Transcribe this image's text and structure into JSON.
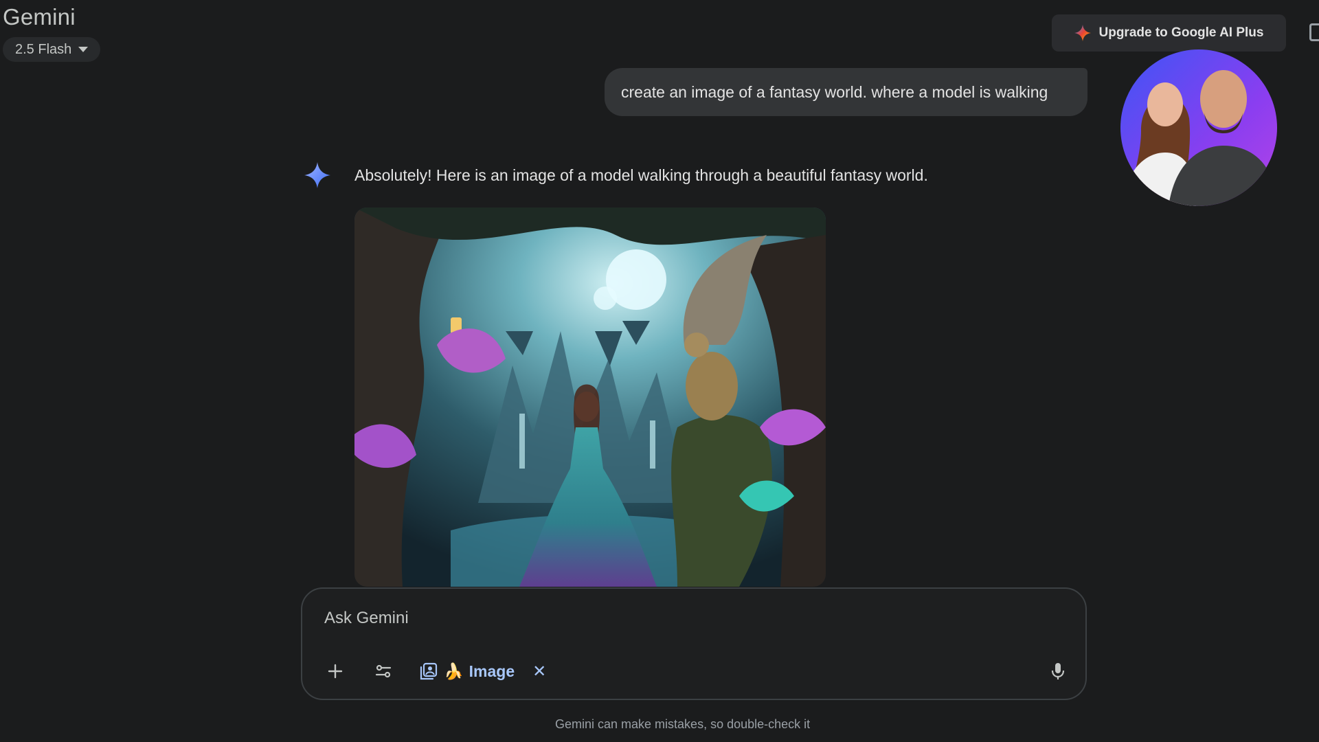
{
  "app": {
    "title": "Gemini",
    "model_selector": "2.5 Flash"
  },
  "header": {
    "upgrade_label": "Upgrade to Google AI Plus"
  },
  "conversation": {
    "user_prompt": "create an image of a fantasy world. where a model is walking",
    "model_reply": "Absolutely! Here is an image of a model walking through a beautiful fantasy world."
  },
  "composer": {
    "placeholder": "Ask Gemini",
    "active_tool_label": "Image",
    "active_tool_emoji": "🍌"
  },
  "footer": {
    "disclaimer": "Gemini can make mistakes, so double-check it"
  },
  "colors": {
    "background": "#1b1c1d",
    "accent": "#a8c7fa",
    "spark": "#4285f4"
  }
}
